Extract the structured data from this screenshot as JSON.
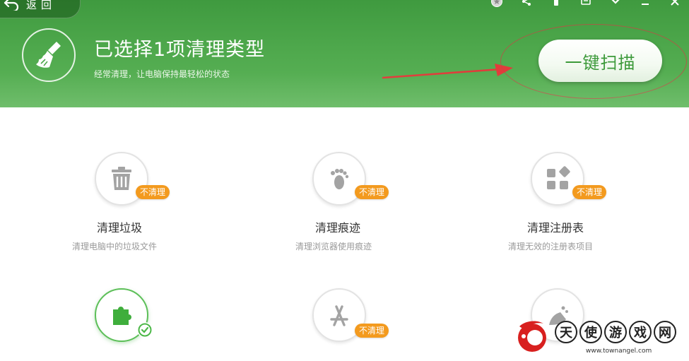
{
  "header": {
    "back_label": "返回",
    "title": "已选择1项清理类型",
    "subtitle": "经常清理，让电脑保持最轻松的状态",
    "scan_button_label": "一键扫描"
  },
  "status_badge_label": "不清理",
  "items": [
    {
      "title": "清理垃圾",
      "desc": "清理电脑中的垃圾文件",
      "badge": "不清理",
      "icon": "trash-icon"
    },
    {
      "title": "清理痕迹",
      "desc": "清理浏览器使用痕迹",
      "badge": "不清理",
      "icon": "footprint-icon"
    },
    {
      "title": "清理注册表",
      "desc": "清理无效的注册表项目",
      "badge": "不清理",
      "icon": "blocks-icon"
    },
    {
      "title": "",
      "desc": "",
      "badge": "",
      "icon": "puzzle-icon",
      "selected": true
    },
    {
      "title": "",
      "desc": "",
      "badge": "不清理",
      "icon": "app-store-icon"
    },
    {
      "title": "",
      "desc": "",
      "badge": "",
      "icon": "broom-dust-icon"
    }
  ],
  "watermark": {
    "chars": [
      "天",
      "使",
      "游",
      "戏",
      "网"
    ],
    "url": "www.townangel.com"
  },
  "colors": {
    "header_green": "#4ea84c",
    "badge_orange": "#f39a1e",
    "scan_text_green": "#3d9a3b",
    "annotation_red": "#e23b3b"
  }
}
